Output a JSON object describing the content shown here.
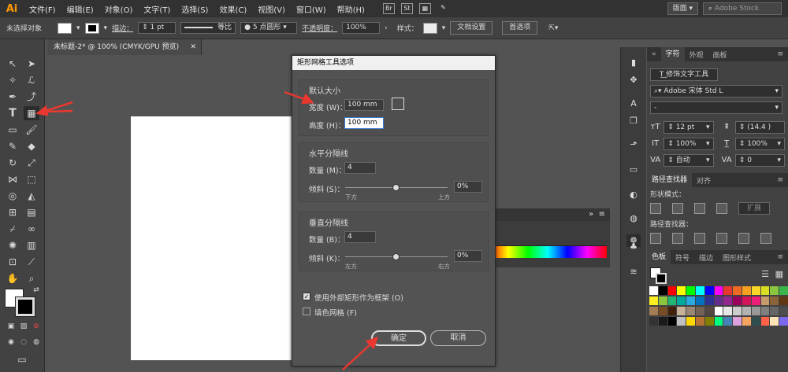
{
  "app": {
    "logo": "Ai",
    "menus": [
      "文件(F)",
      "编辑(E)",
      "对象(O)",
      "文字(T)",
      "选择(S)",
      "效果(C)",
      "视图(V)",
      "窗口(W)",
      "帮助(H)"
    ],
    "bridge_btn": "Br",
    "stock_btn": "St",
    "workspace": "版面",
    "stock_search_placeholder": "Adobe Stock"
  },
  "control_bar": {
    "selection_label": "未选择对象",
    "stroke_label": "描边：",
    "stroke_value": "1 pt",
    "stroke_profile": "等比",
    "brush": "5 点圆形",
    "opacity_label": "不透明度：",
    "opacity_value": "100%",
    "style_label": "样式：",
    "doc_setup": "文档设置",
    "preferences": "首选项"
  },
  "document_tab": "未标题-2* @ 100% (CMYK/GPU 预览)",
  "dialog": {
    "title": "矩形网格工具选项",
    "default_size": {
      "title": "默认大小",
      "width_label": "宽度 (W)：",
      "width_value": "100 mm",
      "height_label": "高度 (H)：",
      "height_value": "100 mm"
    },
    "horizontal": {
      "title": "水平分隔线",
      "count_label": "数量 (M)：",
      "count_value": "4",
      "skew_label": "倾斜 (S)：",
      "skew_value": "0%",
      "skew_fraction": 0.5,
      "left_caption": "下方",
      "right_caption": "上方"
    },
    "vertical": {
      "title": "垂直分隔线",
      "count_label": "数量 (B)：",
      "count_value": "4",
      "skew_label": "倾斜 (K)：",
      "skew_value": "0%",
      "skew_fraction": 0.5,
      "left_caption": "左方",
      "right_caption": "右方"
    },
    "use_frame": {
      "label": "使用外部矩形作为框架 (O)",
      "checked": true
    },
    "fill_grid": {
      "label": "填色网格 (F)",
      "checked": false
    },
    "ok": "确定",
    "cancel": "取消"
  },
  "character_panel": {
    "tabs": [
      "字符",
      "外观",
      "画板"
    ],
    "touch_type_btn": "修饰文字工具",
    "font_family": "Adobe 宋体 Std L",
    "font_style": "-",
    "font_size": "12 pt",
    "leading": "(14.4 )",
    "vscale": "100%",
    "hscale": "100%",
    "kerning": "自动",
    "tracking": "0"
  },
  "pathfinder_panel": {
    "tabs": [
      "路径查找器",
      "对齐"
    ],
    "shape_modes_label": "形状模式：",
    "expand_btn": "扩展",
    "pathfinders_label": "路径查找器："
  },
  "swatches_panel": {
    "tabs": [
      "色板",
      "符号",
      "描边",
      "图形样式"
    ]
  },
  "colors": {
    "accent_ai": "#ff9a00",
    "annotation_red": "#e8382f"
  }
}
